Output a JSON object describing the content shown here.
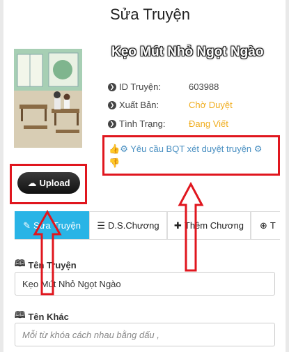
{
  "page": {
    "title": "Sửa Truyện"
  },
  "story": {
    "title": "Kẹo Mút Nhỏ Ngọt Ngào",
    "info": [
      {
        "label": "ID Truyện:",
        "value": "603988",
        "value_color": "#444444"
      },
      {
        "label": "Xuất Bản:",
        "value": "Chờ Duyệt",
        "value_color": "#f0ad1e"
      },
      {
        "label": "Tình Trạng:",
        "value": "Đang Viết",
        "value_color": "#f0ad1e"
      }
    ],
    "request_review_label": "Yêu cầu BQT xét duyệt truyện"
  },
  "upload": {
    "label": "Upload"
  },
  "tabs": [
    {
      "label": "Sửa Truyện",
      "active": true
    },
    {
      "label": "D.S.Chương",
      "active": false
    },
    {
      "label": "Thêm Chương",
      "active": false
    },
    {
      "label": "T",
      "active": false
    }
  ],
  "form": {
    "story_name": {
      "label": "Tên Truyện",
      "value": "Kẹo Mút Nhỏ Ngọt Ngào"
    },
    "other_name": {
      "label": "Tên Khác",
      "placeholder": "Mỗi từ khóa cách nhau bằng dấu ,"
    }
  },
  "colors": {
    "accent": "#29b4e6",
    "annotation": "#e0161e",
    "link": "#4a90c2",
    "status": "#f0ad1e"
  }
}
